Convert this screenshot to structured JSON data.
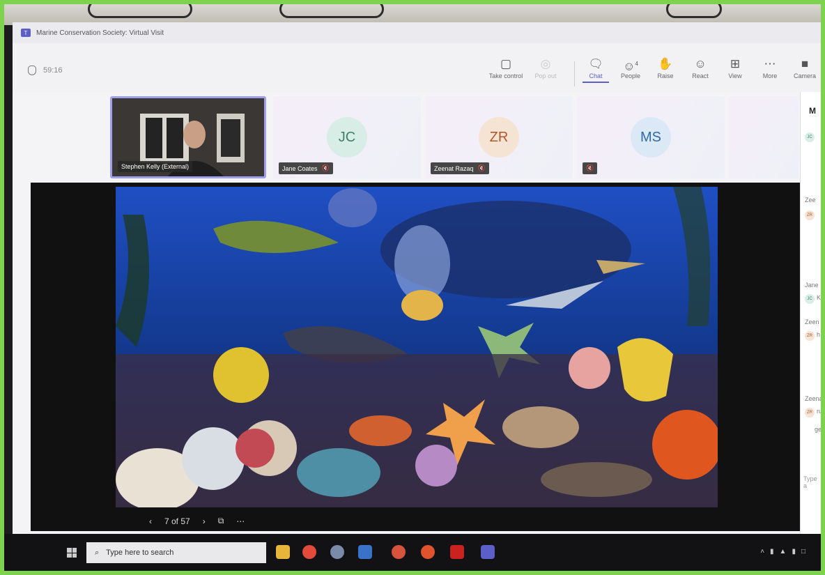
{
  "window": {
    "title": "Marine Conservation Society: Virtual Visit"
  },
  "meeting": {
    "timer": "59:16"
  },
  "toolbar": {
    "take_control": "Take control",
    "pop_out": "Pop out",
    "chat": "Chat",
    "people": "People",
    "people_count": "4",
    "raise": "Raise",
    "react": "React",
    "view": "View",
    "more": "More",
    "camera": "Camera"
  },
  "participants": [
    {
      "name": "Stephen Kelly (External)"
    },
    {
      "initials": "JC",
      "name": "Jane Coates"
    },
    {
      "initials": "ZR",
      "name": "Zeenat Razaq"
    },
    {
      "initials": "MS",
      "name": ""
    }
  ],
  "side_panel": {
    "heading": "M",
    "entries": [
      {
        "initials": "JC",
        "name": ""
      },
      {
        "initials": "ZR",
        "name": "Zee",
        "text": ""
      },
      {
        "initials": "JC",
        "name": "Jane",
        "text": "K"
      },
      {
        "initials": "ZR",
        "name": "Zeen",
        "text": "h"
      },
      {
        "initials": "ZR",
        "name": "Zeena",
        "text": "rui"
      }
    ],
    "extra_text": "ge",
    "type_placeholder": "Type a"
  },
  "slide": {
    "counter": "7 of 57"
  },
  "taskbar": {
    "search_placeholder": "Type here to search"
  },
  "colors": {
    "teams_accent": "#5b5fc7",
    "frame_green": "#7dd24e"
  },
  "icons": [
    "shield-icon",
    "take-control-icon",
    "pop-out-icon",
    "chat-icon",
    "people-icon",
    "raise-hand-icon",
    "react-icon",
    "view-icon",
    "more-icon",
    "camera-icon",
    "mic-off-icon",
    "prev-icon",
    "next-icon",
    "grid-icon",
    "more-dots-icon",
    "windows-icon",
    "search-icon"
  ]
}
